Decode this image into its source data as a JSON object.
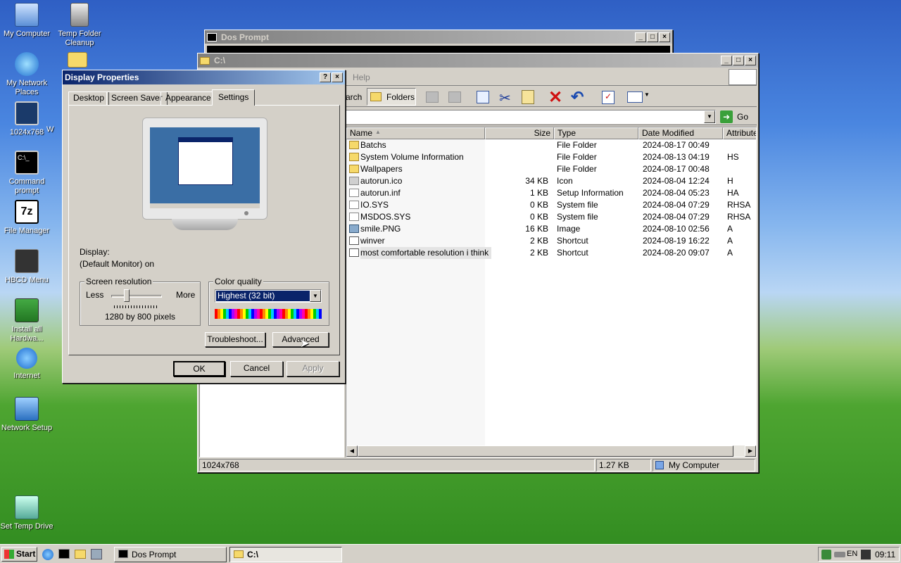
{
  "desktop": {
    "icons": [
      "My Computer",
      "Temp Folder Cleanup",
      "My Network Places",
      "1024x768",
      "W",
      "Command prompt",
      "File Manager",
      "HBCD Menu",
      "Install all Hardwa...",
      "Internet",
      "Network Setup",
      "Set Temp Drive"
    ]
  },
  "dos_window": {
    "title": "Dos Prompt"
  },
  "explorer": {
    "title": "C:\\",
    "menu_help": "Help",
    "toolbar": {
      "search": "arch",
      "folders": "Folders"
    },
    "go": "Go",
    "columns": [
      "Name",
      "Size",
      "Type",
      "Date Modified",
      "Attributes"
    ],
    "files": [
      {
        "name": "Batchs",
        "size": "",
        "type": "File Folder",
        "date": "2024-08-17 00:49",
        "attr": ""
      },
      {
        "name": "System Volume Information",
        "size": "",
        "type": "File Folder",
        "date": "2024-08-13 04:19",
        "attr": "HS"
      },
      {
        "name": "Wallpapers",
        "size": "",
        "type": "File Folder",
        "date": "2024-08-17 00:48",
        "attr": ""
      },
      {
        "name": "autorun.ico",
        "size": "34 KB",
        "type": "Icon",
        "date": "2024-08-04 12:24",
        "attr": "H"
      },
      {
        "name": "autorun.inf",
        "size": "1 KB",
        "type": "Setup Information",
        "date": "2024-08-04 05:23",
        "attr": "HA"
      },
      {
        "name": "IO.SYS",
        "size": "0 KB",
        "type": "System file",
        "date": "2024-08-04 07:29",
        "attr": "RHSA"
      },
      {
        "name": "MSDOS.SYS",
        "size": "0 KB",
        "type": "System file",
        "date": "2024-08-04 07:29",
        "attr": "RHSA"
      },
      {
        "name": "smile.PNG",
        "size": "16 KB",
        "type": "Image",
        "date": "2024-08-10 02:56",
        "attr": "A"
      },
      {
        "name": "winver",
        "size": "2 KB",
        "type": "Shortcut",
        "date": "2024-08-19 16:22",
        "attr": "A"
      },
      {
        "name": "most comfortable resolution i think",
        "size": "2 KB",
        "type": "Shortcut",
        "date": "2024-08-20 09:07",
        "attr": "A"
      }
    ],
    "status": {
      "left": "1024x768",
      "size": "1.27 KB",
      "location": "My Computer"
    }
  },
  "display_properties": {
    "title": "Display Properties",
    "help": "?",
    "tabs": [
      "Desktop",
      "Screen Saver",
      "Appearance",
      "Settings"
    ],
    "display_label": "Display:",
    "display_value": "(Default Monitor) on",
    "screen_resolution": {
      "label": "Screen resolution",
      "less": "Less",
      "more": "More",
      "value": "1280 by 800 pixels"
    },
    "color_quality": {
      "label": "Color quality",
      "selected": "Highest (32 bit)"
    },
    "buttons": {
      "troubleshoot": "Troubleshoot...",
      "advanced": "Advanced",
      "ok": "OK",
      "cancel": "Cancel",
      "apply": "Apply"
    }
  },
  "taskbar": {
    "start": "Start",
    "tasks": [
      "Dos Prompt",
      "C:\\"
    ],
    "lang": "EN",
    "clock": "09:11"
  }
}
